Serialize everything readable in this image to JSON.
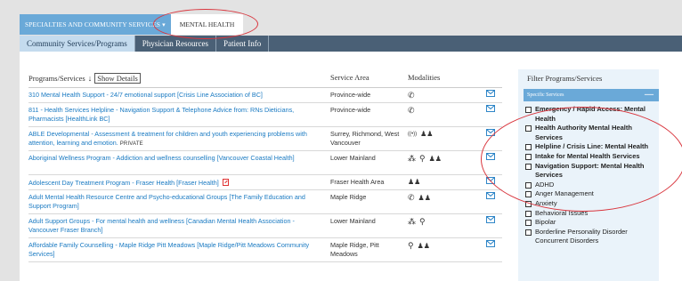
{
  "nav": {
    "specialties_label": "SPECIALTIES AND COMMUNITY SERVICES",
    "current_label": "MENTAL HEALTH"
  },
  "tabs": [
    {
      "label": "Community Services/Programs",
      "active": true
    },
    {
      "label": "Physician Resources",
      "active": false
    },
    {
      "label": "Patient Info",
      "active": false
    }
  ],
  "table": {
    "headers": {
      "programs": "Programs/Services",
      "show_details": "Show Details",
      "area": "Service Area",
      "modalities": "Modalities"
    },
    "rows": [
      {
        "program": "310 Mental Health Support - 24/7 emotional support [Crisis Line Association of BC]",
        "area": "Province-wide",
        "modalities": [
          "phone"
        ]
      },
      {
        "program": "811 - Health Services Helpline - Navigation Support & Telephone Advice from: RNs Dieticians, Pharmacists [HealthLink BC]",
        "area": "Province-wide",
        "modalities": [
          "phone"
        ]
      },
      {
        "program": "ABLE Developmental - Assessment & treatment for children and youth experiencing problems with attention, learning and emotion.",
        "private": "PRIVATE",
        "area": "Surrey, Richmond, West Vancouver",
        "modalities": [
          "virtual",
          "in-person"
        ]
      },
      {
        "program": "Aboriginal Wellness Program - Addiction and wellness counselling [Vancouver Coastal Health]",
        "area": "Lower Mainland",
        "modalities": [
          "group",
          "location",
          "in-person"
        ]
      },
      {
        "program": "Adolescent Day Treatment Program - Fraser Health [Fraser Health]",
        "area": "Fraser Health Area",
        "modalities": [
          "in-person"
        ],
        "pdf": true
      },
      {
        "program": "Adult Mental Health Resource Centre and Psycho-educational Groups [The Family Education and Support Program]",
        "area": "Maple Ridge",
        "modalities": [
          "phone",
          "in-person"
        ]
      },
      {
        "program": "Adult Support Groups - For mental health and wellness [Canadian Mental Health Association - Vancouver Fraser Branch]",
        "area": "Lower Mainland",
        "modalities": [
          "group",
          "location"
        ]
      },
      {
        "program": "Affordable Family Counselling - Maple Ridge Pitt Meadows [Maple Ridge/Pitt Meadows Community Services]",
        "area": "Maple Ridge, Pitt Meadows",
        "modalities": [
          "location",
          "in-person"
        ]
      }
    ]
  },
  "filter": {
    "title": "Filter Programs/Services",
    "section_label": "Specific Services",
    "collapse_glyph": "—",
    "items": [
      {
        "label": "Emergency / Rapid Access: Mental Health",
        "bold": true
      },
      {
        "label": "Health Authority Mental Health Services",
        "bold": true
      },
      {
        "label": "Helpline / Crisis Line: Mental Health",
        "bold": true
      },
      {
        "label": "Intake for Mental Health Services",
        "bold": true
      },
      {
        "label": "Navigation Support: Mental Health Services",
        "bold": true
      },
      {
        "label": "ADHD",
        "bold": false
      },
      {
        "label": "Anger Management",
        "bold": false
      },
      {
        "label": "Anxiety",
        "bold": false
      },
      {
        "label": "Behavioral Issues",
        "bold": false
      },
      {
        "label": "Bipolar",
        "bold": false
      },
      {
        "label": "Borderline Personality Disorder",
        "bold": false
      },
      {
        "label": "Concurrent Disorders",
        "bold": false,
        "no_checkbox": true
      }
    ]
  },
  "colors": {
    "link": "#1a7ac2",
    "nav_dark": "#4a6076",
    "nav_light": "#6aa9d8",
    "annotation": "#d9363e"
  }
}
